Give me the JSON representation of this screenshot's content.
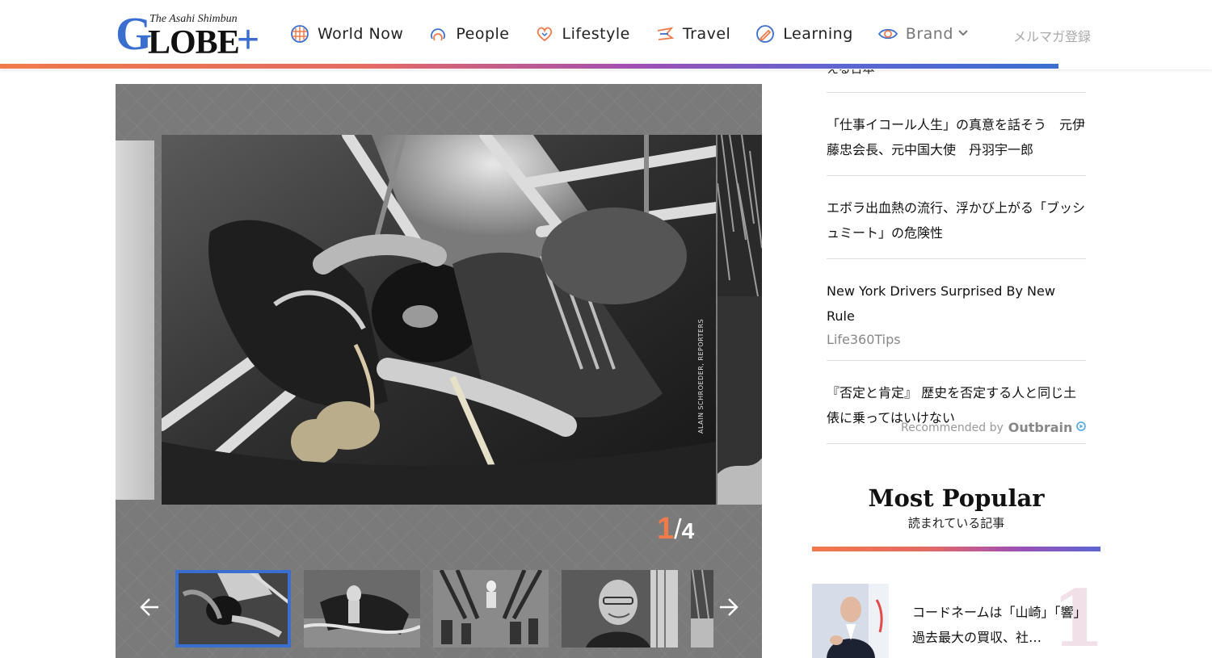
{
  "header": {
    "logo_top": "The Asahi Shimbun",
    "logo_g": "G",
    "logo_rest": "LOBE",
    "logo_plus": "+",
    "nav": [
      {
        "label": "World Now",
        "icon": "globe-icon"
      },
      {
        "label": "People",
        "icon": "people-icon"
      },
      {
        "label": "Lifestyle",
        "icon": "heart-icon"
      },
      {
        "label": "Travel",
        "icon": "plane-icon"
      },
      {
        "label": "Learning",
        "icon": "pencil-icon"
      },
      {
        "label": "Brand",
        "icon": "eye-icon"
      }
    ],
    "mailmag": "メルマガ登録",
    "accent": "#3a6fd0",
    "orange": "#f07a4a"
  },
  "gallery": {
    "credit": "ALAIN SCHROEDER, REPORTERS",
    "current": "1",
    "separator": "/",
    "total": "4"
  },
  "sidebar": {
    "cut_title": "える日本",
    "recommended": [
      {
        "title": "「仕事イコール人生」の真意を話そう　元伊藤忠会長、元中国大使　丹羽宇一郎",
        "source": ""
      },
      {
        "title": "エボラ出血熱の流行、浮かび上がる「ブッシュミート」の危険性",
        "source": ""
      },
      {
        "title": "New York Drivers Surprised By New Rule",
        "source": "Life360Tips"
      },
      {
        "title": "『否定と肯定』 歴史を否定する人と同じ土俵に乗ってはいけない",
        "source": ""
      }
    ],
    "recommended_by": "Recommended by",
    "outbrain": "Outbrain",
    "popular_title": "Most Popular",
    "popular_sub": "読まれている記事",
    "popular": [
      {
        "rank": "1",
        "title": "コードネームは「山崎」「響」　過去最大の買収、社…"
      }
    ]
  }
}
